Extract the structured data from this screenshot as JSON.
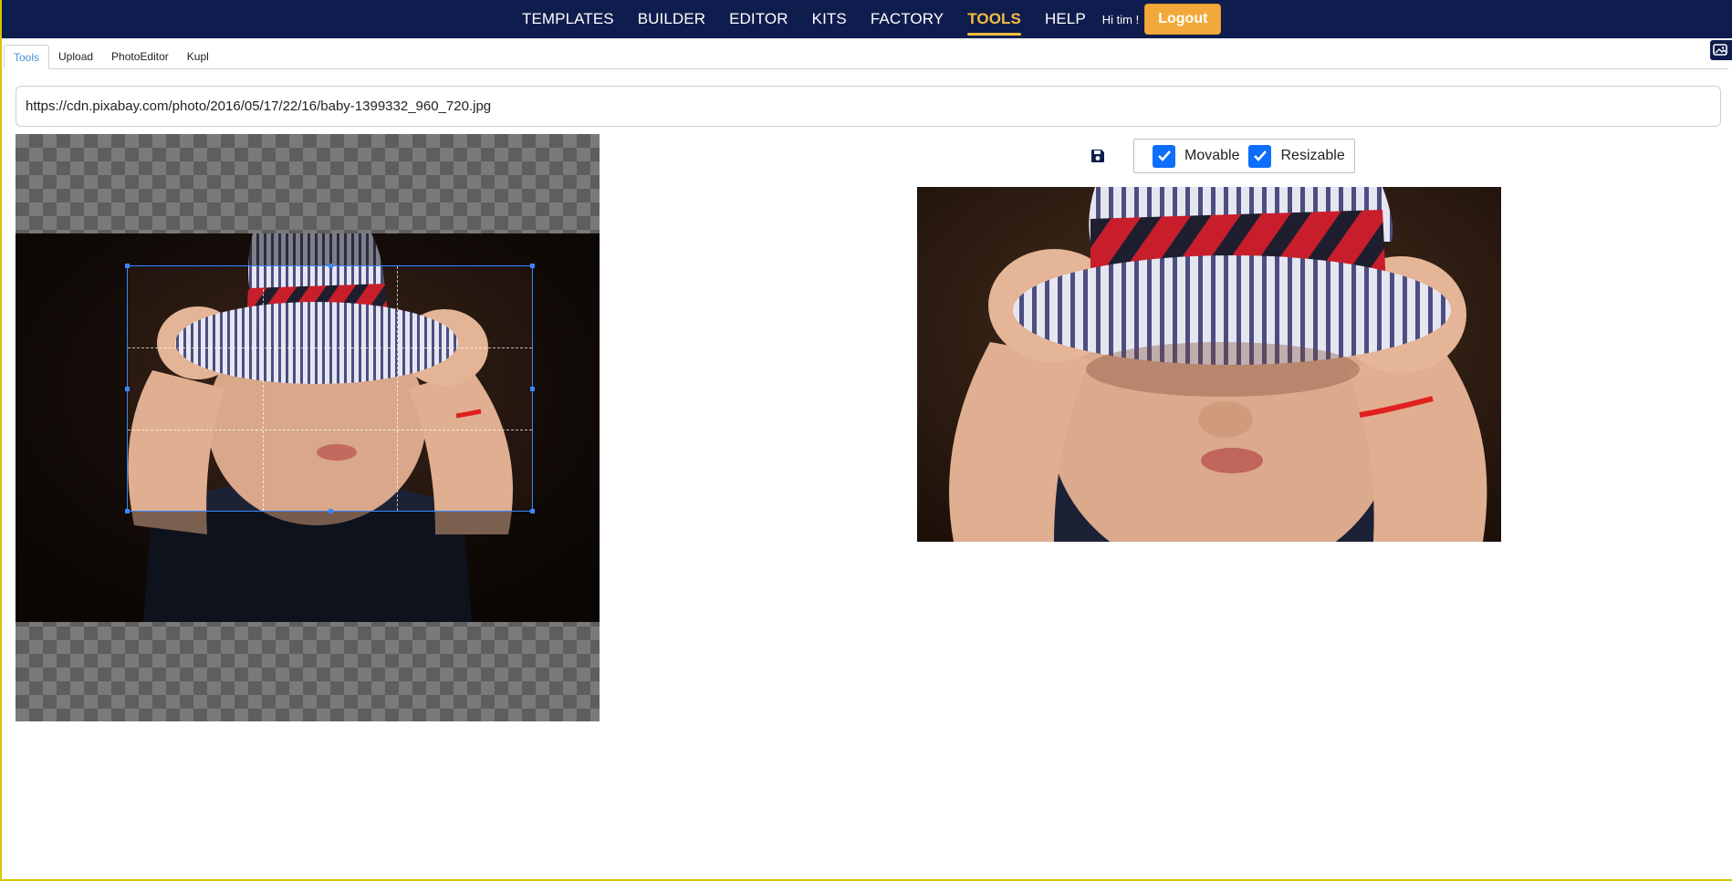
{
  "nav": {
    "links": [
      {
        "label": "TEMPLATES",
        "active": false
      },
      {
        "label": "BUILDER",
        "active": false
      },
      {
        "label": "EDITOR",
        "active": false
      },
      {
        "label": "KITS",
        "active": false
      },
      {
        "label": "FACTORY",
        "active": false
      },
      {
        "label": "TOOLS",
        "active": true
      },
      {
        "label": "HELP",
        "active": false
      }
    ],
    "greeting": "Hi tim !",
    "logout_label": "Logout"
  },
  "tabs": [
    {
      "label": "Tools",
      "active": true
    },
    {
      "label": "Upload",
      "active": false
    },
    {
      "label": "PhotoEditor",
      "active": false
    },
    {
      "label": "Kupl",
      "active": false
    }
  ],
  "url_input": {
    "value": "https://cdn.pixabay.com/photo/2016/05/17/22/16/baby-1399332_960_720.jpg"
  },
  "options": {
    "movable_label": "Movable",
    "movable_checked": true,
    "resizable_label": "Resizable",
    "resizable_checked": true
  },
  "icons": {
    "save": "save-icon",
    "corner": "image-icon"
  },
  "colors": {
    "navbar": "#0f1d4e",
    "active_nav": "#f5bd3b",
    "logout": "#f3a93a",
    "checkbox": "#0d6efd",
    "crop_border": "#3a86ff"
  }
}
